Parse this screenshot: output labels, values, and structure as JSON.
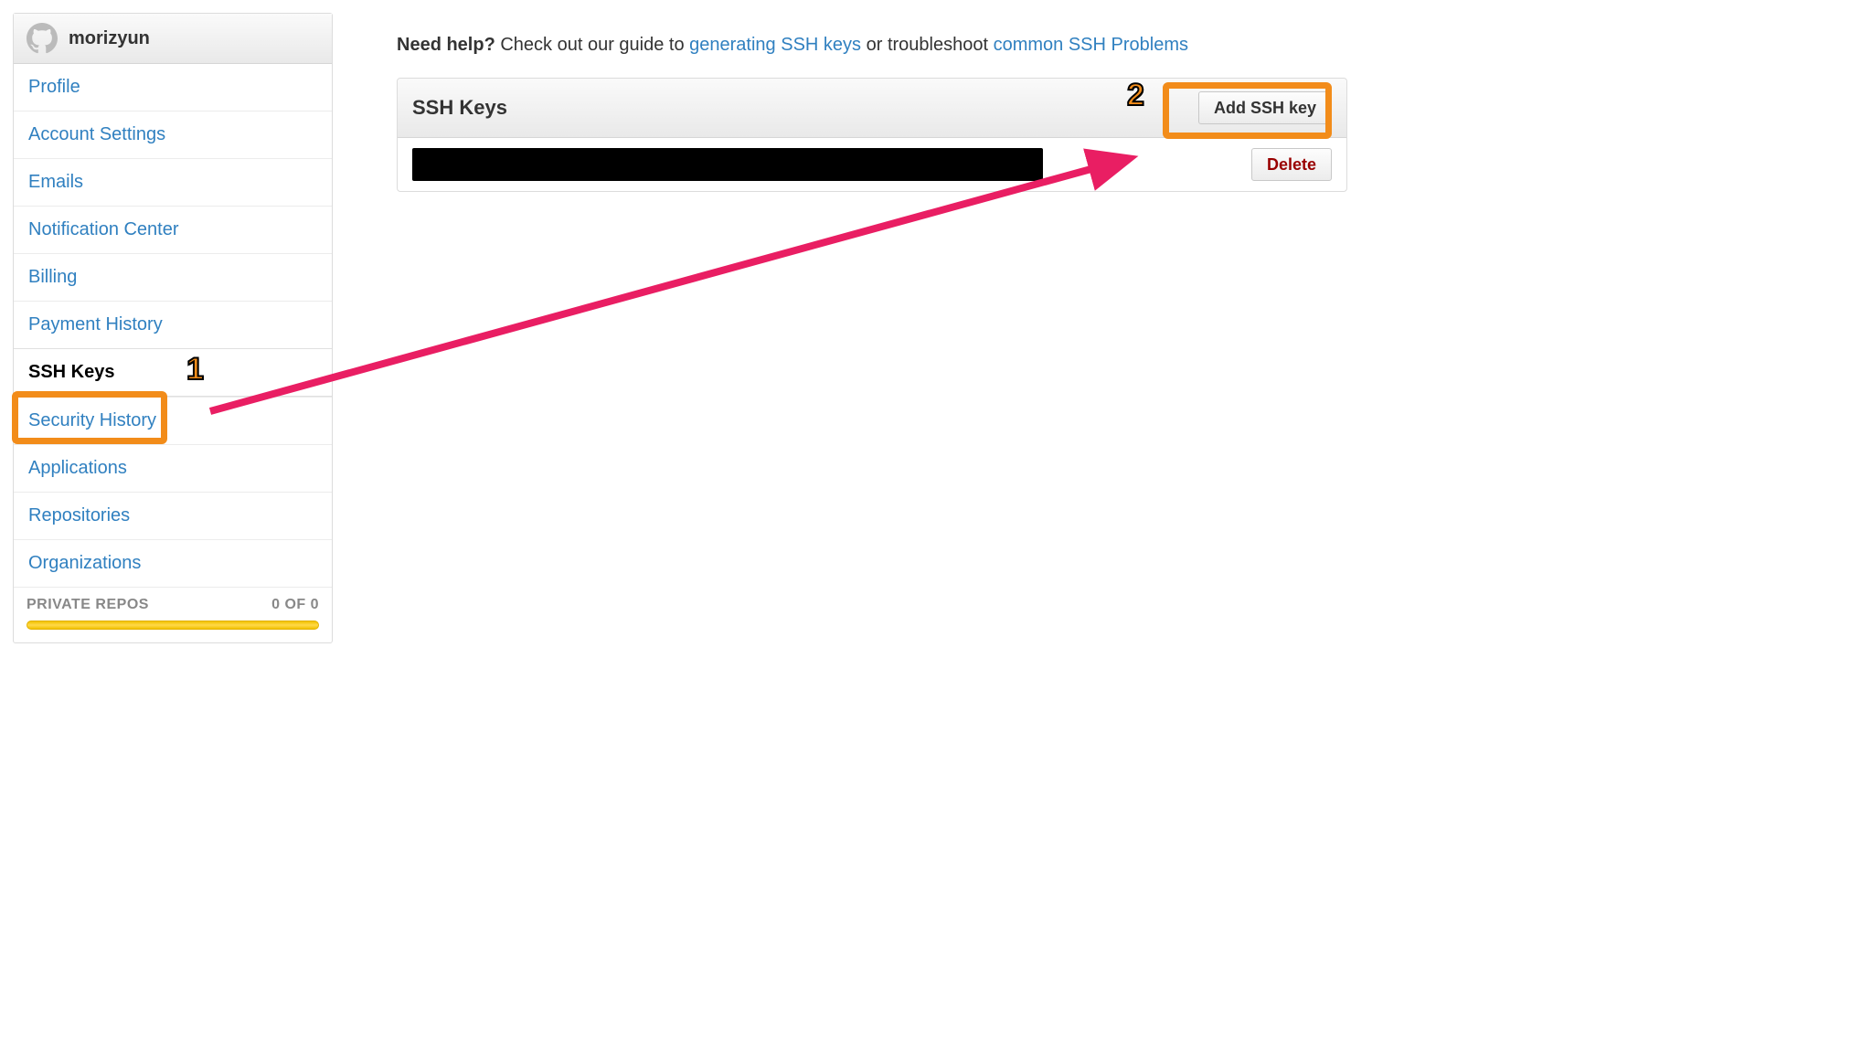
{
  "sidebar": {
    "username": "morizyun",
    "items": [
      {
        "label": "Profile",
        "active": false
      },
      {
        "label": "Account Settings",
        "active": false
      },
      {
        "label": "Emails",
        "active": false
      },
      {
        "label": "Notification Center",
        "active": false
      },
      {
        "label": "Billing",
        "active": false
      },
      {
        "label": "Payment History",
        "active": false
      },
      {
        "label": "SSH Keys",
        "active": true
      },
      {
        "label": "Security History",
        "active": false
      },
      {
        "label": "Applications",
        "active": false
      },
      {
        "label": "Repositories",
        "active": false
      },
      {
        "label": "Organizations",
        "active": false
      }
    ],
    "footer": {
      "label": "PRIVATE REPOS",
      "usage": "0 OF 0"
    }
  },
  "help": {
    "bold": "Need help?",
    "t1": " Check out our guide to ",
    "link1": "generating SSH keys",
    "t2": " or troubleshoot ",
    "link2": "common SSH Problems"
  },
  "panel": {
    "title": "SSH Keys",
    "add_button": "Add SSH key",
    "delete_button": "Delete"
  },
  "annotations": {
    "marker1": "1",
    "marker2": "2"
  }
}
